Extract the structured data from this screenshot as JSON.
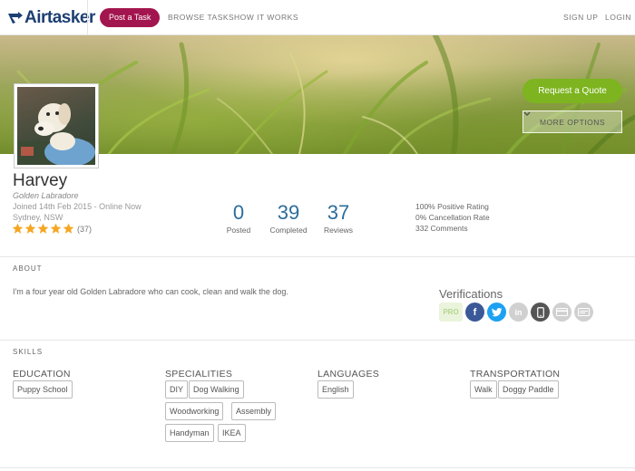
{
  "nav": {
    "logo": "Airtasker",
    "post_task": "Post a Task",
    "browse": "BROWSE TASKS",
    "how": "HOW IT WORKS",
    "signup": "SIGN UP",
    "login": "LOGIN"
  },
  "hero": {
    "request_quote": "Request a Quote",
    "more_options": "MORE OPTIONS"
  },
  "profile": {
    "name": "Harvey",
    "tagline": "Golden Labradore",
    "joined": "Joined 14th Feb 2015 - Online Now",
    "location": "Sydney, NSW",
    "star_rating": 5,
    "review_count_label": "(37)"
  },
  "stats": [
    {
      "value": "0",
      "label": "Posted"
    },
    {
      "value": "39",
      "label": "Completed"
    },
    {
      "value": "37",
      "label": "Reviews"
    }
  ],
  "ratings": {
    "positive": "100% Positive Rating",
    "cancellation": "0% Cancellation Rate",
    "comments": "332 Comments"
  },
  "about": {
    "heading": "ABOUT",
    "text": "I'm a four year old Golden Labradore who can cook, clean and walk the dog."
  },
  "verifications": {
    "title": "Verifications",
    "badges": [
      {
        "icon": "pro-badge",
        "text": "PRO",
        "color": "#eaf4dc",
        "active": false
      },
      {
        "icon": "facebook-icon",
        "text": "f",
        "color": "#3b5998",
        "active": true
      },
      {
        "icon": "twitter-icon",
        "text": "",
        "color": "#1da1f2",
        "active": true
      },
      {
        "icon": "linkedin-icon",
        "text": "in",
        "color": "#d0d0d0",
        "active": false
      },
      {
        "icon": "mobile-icon",
        "text": "",
        "color": "#555555",
        "active": true
      },
      {
        "icon": "credit-card-icon",
        "text": "",
        "color": "#d0d0d0",
        "active": false
      },
      {
        "icon": "id-card-icon",
        "text": "",
        "color": "#d0d0d0",
        "active": false
      }
    ]
  },
  "skills": {
    "heading": "SKILLS",
    "education": {
      "title": "EDUCATION",
      "items": [
        "Puppy School"
      ]
    },
    "specialities": {
      "title": "SPECIALITIES",
      "items": [
        "DIY",
        "Dog Walking",
        "Woodworking",
        "Assembly",
        "Handyman",
        "IKEA"
      ]
    },
    "languages": {
      "title": "LANGUAGES",
      "items": [
        "English"
      ]
    },
    "transportation": {
      "title": "TRANSPORTATION",
      "items": [
        "Walk",
        "Doggy Paddle"
      ]
    }
  },
  "colors": {
    "brand": "#1d3f73",
    "post_task": "#a3154e",
    "quote_green": "#7db41f",
    "stat_blue": "#2c6d9c",
    "star": "#f5a623"
  }
}
